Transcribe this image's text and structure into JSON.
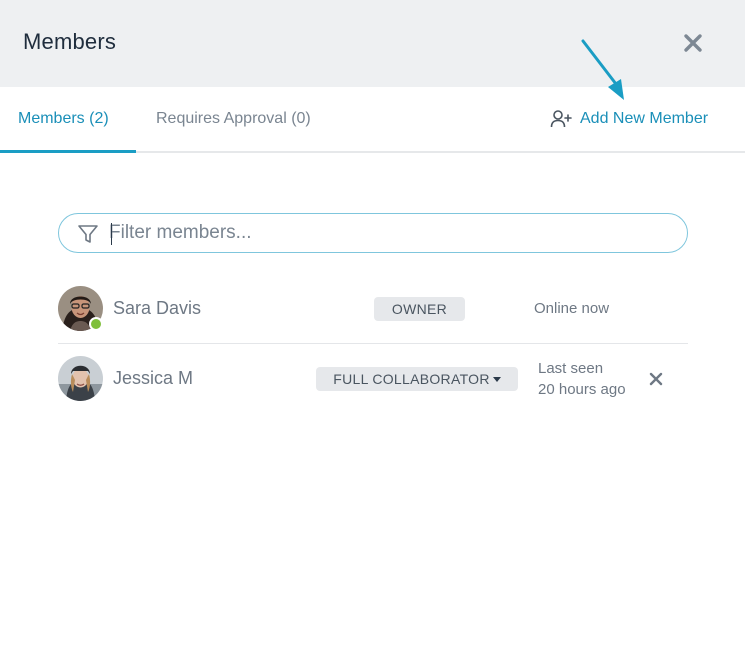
{
  "header": {
    "title": "Members",
    "close_icon": "close-icon"
  },
  "tabs": [
    {
      "label": "Members (2)",
      "active": true
    },
    {
      "label": "Requires Approval (0)",
      "active": false
    }
  ],
  "add_member": {
    "label": "Add New Member",
    "icon": "add-user-icon"
  },
  "filter": {
    "placeholder": "Filter members...",
    "value": "",
    "icon": "filter-icon"
  },
  "members": [
    {
      "name": "Sara Davis",
      "role": "OWNER",
      "status": "Online now",
      "online": true
    },
    {
      "name": "Jessica M",
      "role": "FULL COLLABORATOR",
      "status_line1": "Last seen",
      "status_line2": "20 hours ago",
      "removable": true
    }
  ],
  "colors": {
    "accent": "#1a9dc4",
    "header_bg": "#eef0f2",
    "online": "#7fbf3b",
    "badge_bg": "#e6e8eb"
  }
}
